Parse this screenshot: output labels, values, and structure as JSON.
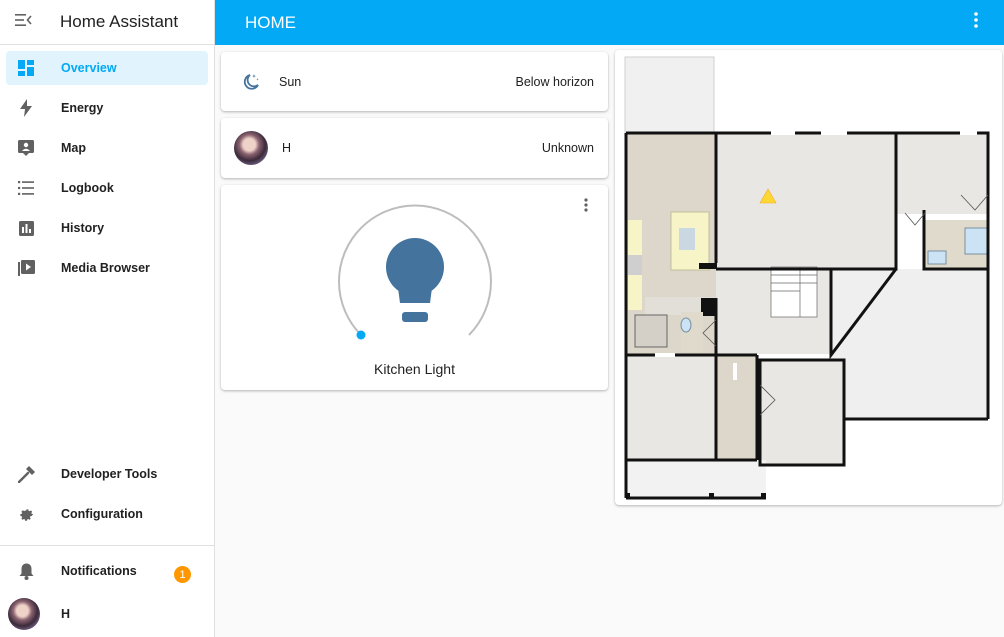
{
  "app": {
    "title": "Home Assistant"
  },
  "sidebar": {
    "items": [
      {
        "label": "Overview",
        "icon": "dashboard-icon",
        "active": true
      },
      {
        "label": "Energy",
        "icon": "lightning-icon"
      },
      {
        "label": "Map",
        "icon": "map-icon"
      },
      {
        "label": "Logbook",
        "icon": "list-icon"
      },
      {
        "label": "History",
        "icon": "chart-icon"
      },
      {
        "label": "Media Browser",
        "icon": "play-box-icon"
      }
    ],
    "bottom_items": [
      {
        "label": "Developer Tools",
        "icon": "hammer-icon"
      },
      {
        "label": "Configuration",
        "icon": "gear-icon"
      }
    ],
    "notifications": {
      "label": "Notifications",
      "count": "1"
    },
    "user": {
      "name": "H"
    }
  },
  "header": {
    "title": "HOME"
  },
  "cards": {
    "sun": {
      "name": "Sun",
      "state": "Below horizon"
    },
    "person": {
      "name": "H",
      "state": "Unknown"
    },
    "light": {
      "name": "Kitchen Light",
      "accent": "#03a9f4",
      "bulb_color": "#44739e"
    }
  },
  "colors": {
    "primary": "#03a9f4",
    "badge": "#ff9800"
  }
}
